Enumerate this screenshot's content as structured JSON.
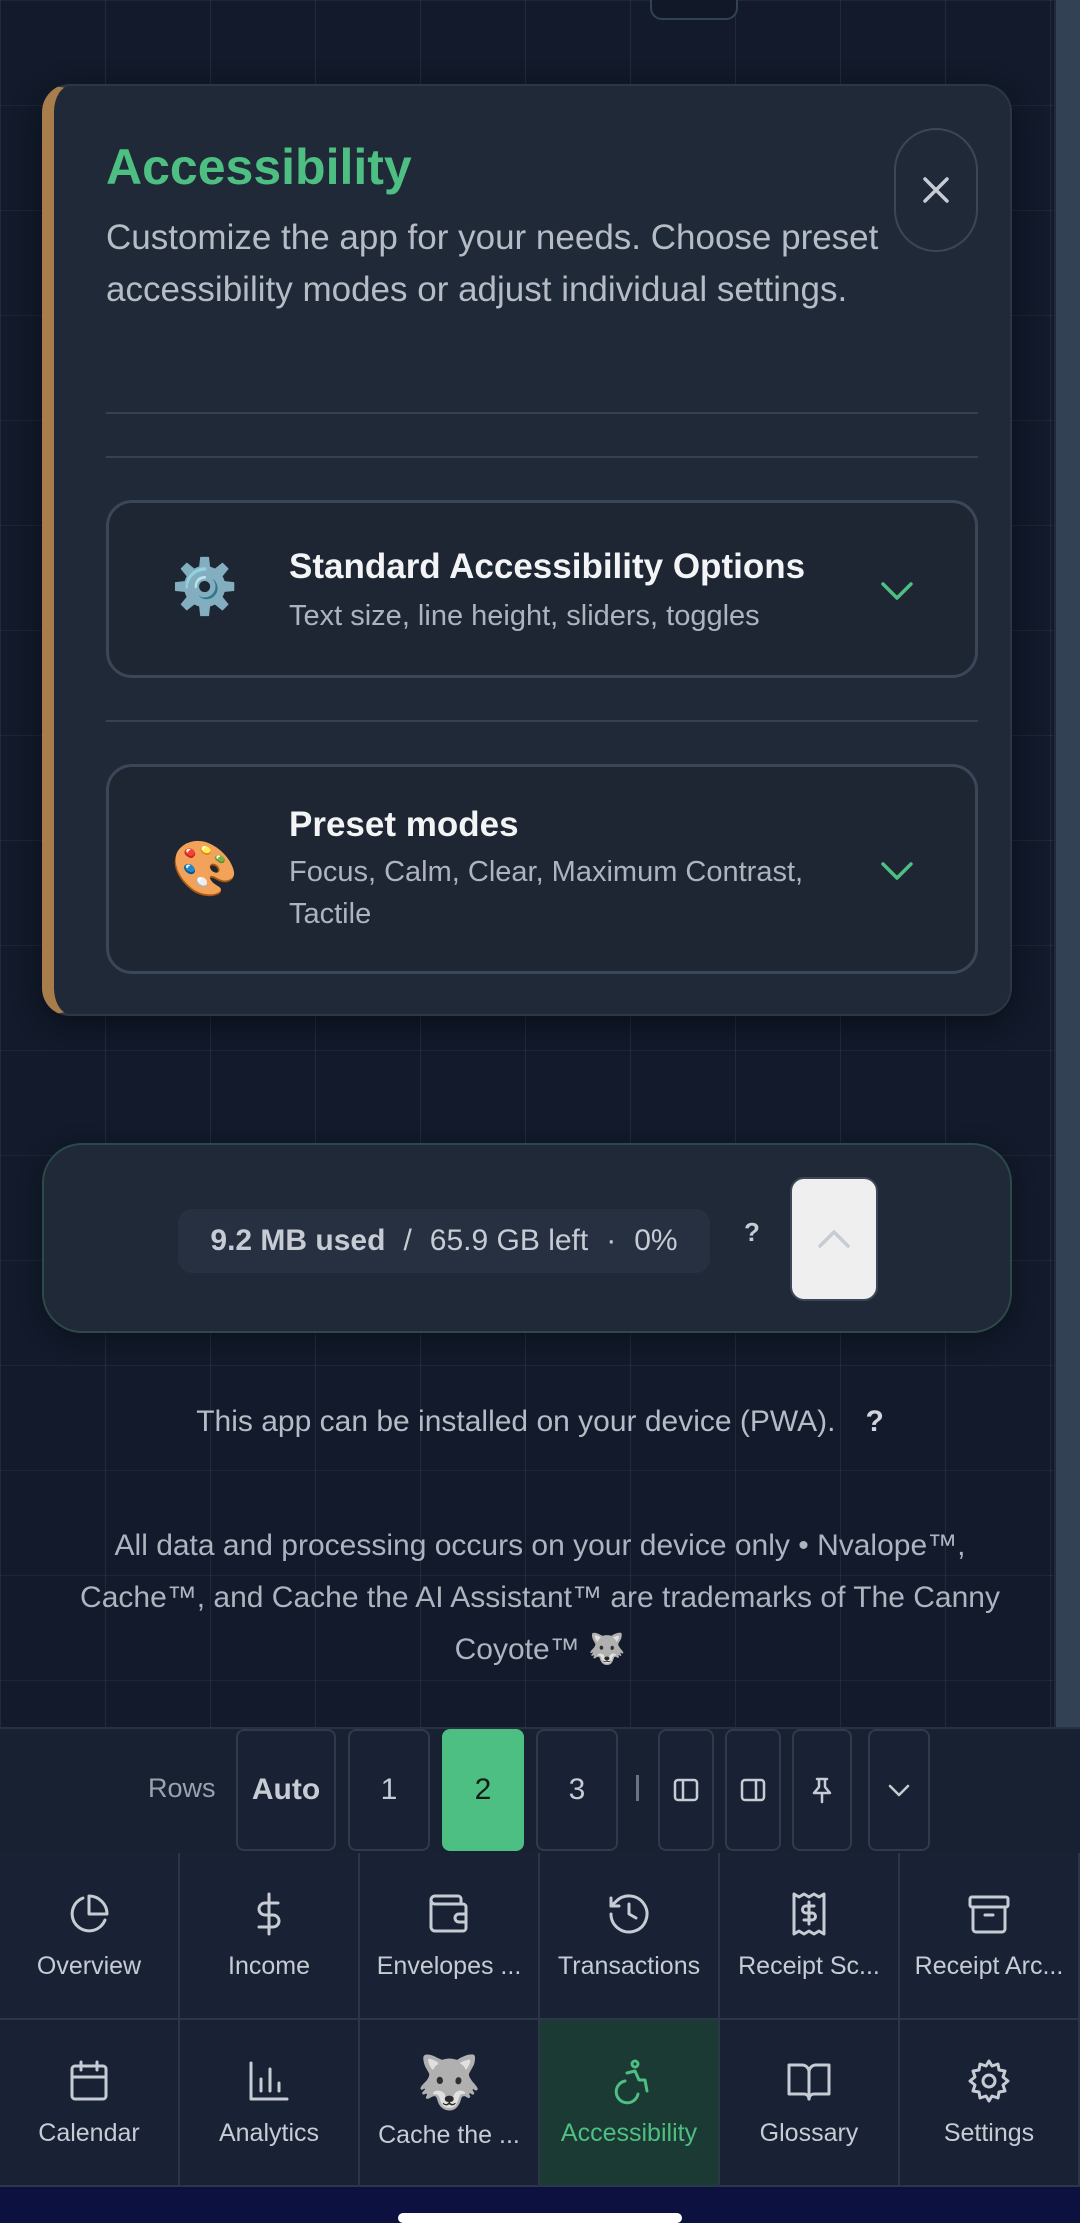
{
  "panel": {
    "title": "Accessibility",
    "description": "Customize the app for your needs. Choose preset accessibility modes or adjust individual settings.",
    "close_icon": "close-icon",
    "accent_color": "#4ebf82",
    "sections": [
      {
        "icon": "⚙️",
        "title": "Standard Accessibility Options",
        "subtitle": "Text size, line height, sliders, toggles"
      },
      {
        "icon": "🎨",
        "title": "Preset modes",
        "subtitle": "Focus, Calm, Clear, Maximum Contrast, Tactile"
      }
    ]
  },
  "storage": {
    "used": "9.2 MB used",
    "separator": "/",
    "left": "65.9 GB left",
    "dot": "·",
    "percent": "0%",
    "help": "?"
  },
  "pwa": {
    "text": "This app can be installed on your device (PWA).",
    "help": "?"
  },
  "footer_note": "All data and processing occurs on your device only • Nvalope™, Cache™, and Cache the AI Assistant™ are trademarks of The Canny Coyote™ 🐺",
  "rows_bar": {
    "label": "Rows",
    "options": [
      "Auto",
      "1",
      "2",
      "3"
    ],
    "selected": "2"
  },
  "nav": {
    "items": [
      {
        "label": "Overview",
        "icon": "pie-chart-icon"
      },
      {
        "label": "Income",
        "icon": "dollar-icon"
      },
      {
        "label": "Envelopes ...",
        "icon": "wallet-icon"
      },
      {
        "label": "Transactions",
        "icon": "history-icon"
      },
      {
        "label": "Receipt Sc...",
        "icon": "receipt-icon"
      },
      {
        "label": "Receipt Arc...",
        "icon": "archive-icon"
      },
      {
        "label": "Calendar",
        "icon": "calendar-icon"
      },
      {
        "label": "Analytics",
        "icon": "bar-chart-icon"
      },
      {
        "label": "Cache the ...",
        "icon": "wolf-icon",
        "emoji": "🐺"
      },
      {
        "label": "Accessibility",
        "icon": "accessibility-icon"
      },
      {
        "label": "Glossary",
        "icon": "book-icon"
      },
      {
        "label": "Settings",
        "icon": "gear-icon"
      }
    ],
    "active": "Accessibility"
  }
}
